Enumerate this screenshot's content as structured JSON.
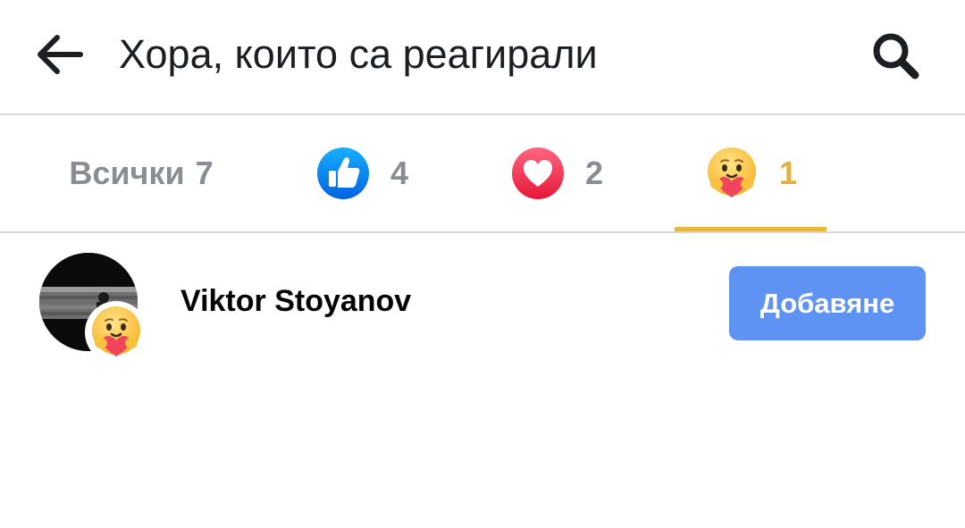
{
  "header": {
    "title": "Хора, които са реагирали",
    "back_icon": "arrow-left-icon",
    "search_icon": "search-icon"
  },
  "tabs": [
    {
      "label": "Всички",
      "count": "7",
      "selected": false
    },
    {
      "icon": "like-reaction-icon",
      "count": "4",
      "selected": false
    },
    {
      "icon": "love-reaction-icon",
      "count": "2",
      "selected": false
    },
    {
      "icon": "care-reaction-icon",
      "count": "1",
      "selected": true
    }
  ],
  "people": [
    {
      "name": "Viktor Stoyanov",
      "reaction_icon": "care-reaction-icon",
      "action_label": "Добавяне"
    }
  ],
  "colors": {
    "accent_tab": "#e8b83e",
    "like_blue": "#1877f2",
    "love_red": "#f33e58",
    "button_blue": "#5f93f3",
    "muted_text": "#8a8d91"
  }
}
